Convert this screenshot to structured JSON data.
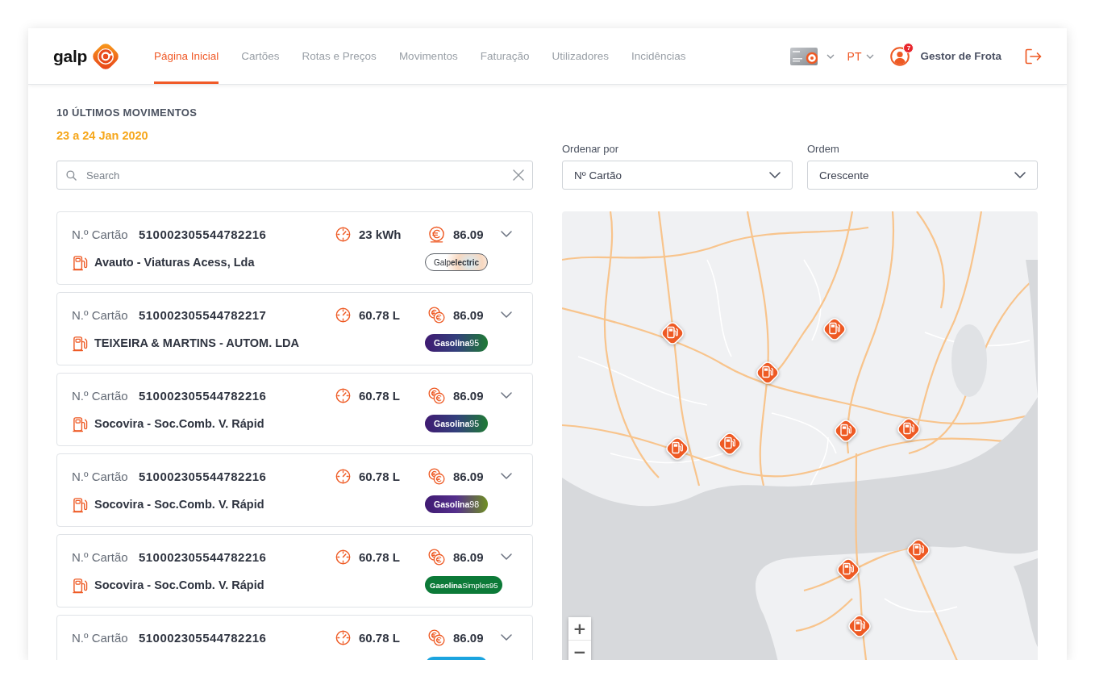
{
  "header": {
    "logo_text": "galp",
    "nav": [
      {
        "label": "Página Inicial",
        "selected": true
      },
      {
        "label": "Cartões",
        "selected": false
      },
      {
        "label": "Rotas e Preços",
        "selected": false
      },
      {
        "label": "Movimentos",
        "selected": false
      },
      {
        "label": "Faturação",
        "selected": false
      },
      {
        "label": "Utilizadores",
        "selected": false
      },
      {
        "label": "Incidências",
        "selected": false
      }
    ],
    "language": "PT",
    "user": {
      "name": "Gestor de Frota",
      "notifications": "7"
    }
  },
  "movements": {
    "title": "10 ÚLTIMOS MOVIMENTOS",
    "period": "23 a 24 Jan 2020",
    "search": {
      "placeholder": "Search"
    },
    "items": [
      {
        "kind": "electric",
        "card_label": "N.º Cartão",
        "card_number": "510002305544782216",
        "quantity": "23 kWh",
        "price": "86.09",
        "expanded": false,
        "station": "Avauto - Viaturas Acess, Lda",
        "badge": {
          "kind": "electric",
          "label": "Galp**electric**"
        }
      },
      {
        "kind": "fuel",
        "card_label": "N.º Cartão",
        "card_number": "510002305544782217",
        "quantity": "60.78 L",
        "price": "86.09",
        "expanded": false,
        "station": "TEIXEIRA & MARTINS - AUTOM. LDA",
        "badge": {
          "kind": "gasolina95",
          "label": "**Gasolina**95"
        }
      },
      {
        "kind": "fuel",
        "card_label": "N.º Cartão",
        "card_number": "510002305544782216",
        "quantity": "60.78 L",
        "price": "86.09",
        "expanded": false,
        "station": "Socovira - Soc.Comb. V. Rápid",
        "badge": {
          "kind": "gasolina95",
          "label": "**Gasolina**95"
        }
      },
      {
        "kind": "fuel",
        "card_label": "N.º Cartão",
        "card_number": "510002305544782216",
        "quantity": "60.78 L",
        "price": "86.09",
        "expanded": false,
        "station": "Socovira - Soc.Comb. V. Rápid",
        "badge": {
          "kind": "gasolina98",
          "label": "**Gasolina**98"
        }
      },
      {
        "kind": "fuel",
        "card_label": "N.º Cartão",
        "card_number": "510002305544782216",
        "quantity": "60.78 L",
        "price": "86.09",
        "expanded": false,
        "station": "Socovira - Soc.Comb. V. Rápid",
        "badge": {
          "kind": "simples95",
          "label": "**Gasolina**Simples95"
        }
      },
      {
        "kind": "fuel",
        "card_label": "N.º Cartão",
        "card_number": "510002305544782216",
        "quantity": "60.78 L",
        "price": "86.09",
        "expanded": false,
        "badge": {
          "kind": "cyan"
        }
      }
    ]
  },
  "filters": [
    {
      "label": "Ordenar por",
      "value": "Nº Cartão"
    },
    {
      "label": "Ordem",
      "value": "Crescente"
    }
  ],
  "map": {
    "zoom_controls": [
      "+",
      "−"
    ]
  }
}
